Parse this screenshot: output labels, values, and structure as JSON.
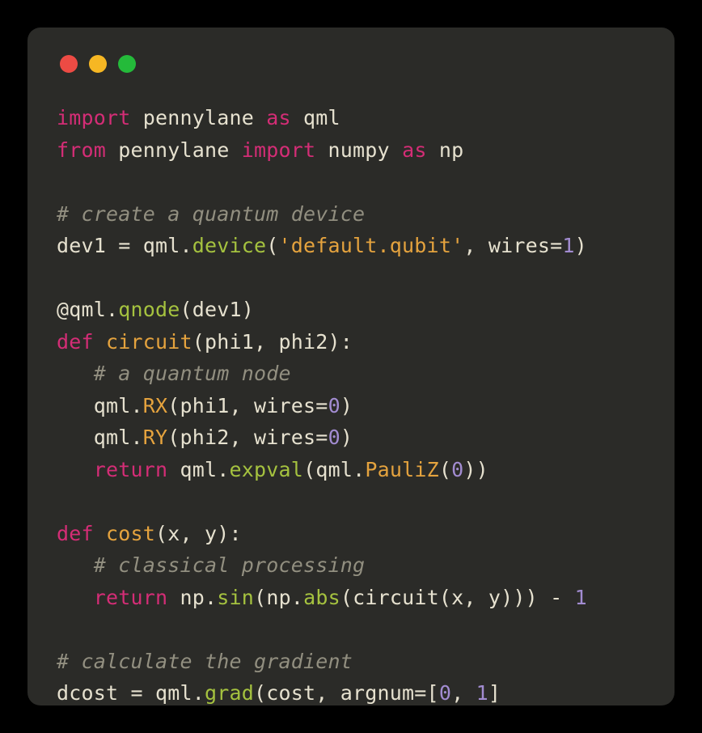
{
  "code": {
    "tokens": [
      [
        [
          "import ",
          "c-keyword"
        ],
        [
          "pennylane ",
          "c-default"
        ],
        [
          "as ",
          "c-keyword"
        ],
        [
          "qml",
          "c-default"
        ]
      ],
      [
        [
          "from ",
          "c-keyword"
        ],
        [
          "pennylane ",
          "c-default"
        ],
        [
          "import ",
          "c-keyword"
        ],
        [
          "numpy ",
          "c-default"
        ],
        [
          "as ",
          "c-keyword"
        ],
        [
          "np",
          "c-default"
        ]
      ],
      [],
      [
        [
          "# create a quantum device",
          "c-comment"
        ]
      ],
      [
        [
          "dev1 = qml.",
          "c-default"
        ],
        [
          "device",
          "c-func"
        ],
        [
          "(",
          "c-default"
        ],
        [
          "'default.qubit'",
          "c-string"
        ],
        [
          ", wires=",
          "c-default"
        ],
        [
          "1",
          "c-number"
        ],
        [
          ")",
          "c-default"
        ]
      ],
      [],
      [
        [
          "@qml.",
          "c-default"
        ],
        [
          "qnode",
          "c-func"
        ],
        [
          "(dev1)",
          "c-default"
        ]
      ],
      [
        [
          "def ",
          "c-keyword"
        ],
        [
          "circuit",
          "c-decor"
        ],
        [
          "(phi1, phi2):",
          "c-default"
        ]
      ],
      [
        [
          "   ",
          "c-default"
        ],
        [
          "# a quantum node",
          "c-comment"
        ]
      ],
      [
        [
          "   qml.",
          "c-default"
        ],
        [
          "RX",
          "c-decor"
        ],
        [
          "(phi1, wires=",
          "c-default"
        ],
        [
          "0",
          "c-number"
        ],
        [
          ")",
          "c-default"
        ]
      ],
      [
        [
          "   qml.",
          "c-default"
        ],
        [
          "RY",
          "c-decor"
        ],
        [
          "(phi2, wires=",
          "c-default"
        ],
        [
          "0",
          "c-number"
        ],
        [
          ")",
          "c-default"
        ]
      ],
      [
        [
          "   ",
          "c-default"
        ],
        [
          "return ",
          "c-keyword"
        ],
        [
          "qml.",
          "c-default"
        ],
        [
          "expval",
          "c-func"
        ],
        [
          "(qml.",
          "c-default"
        ],
        [
          "PauliZ",
          "c-decor"
        ],
        [
          "(",
          "c-default"
        ],
        [
          "0",
          "c-number"
        ],
        [
          "))",
          "c-default"
        ]
      ],
      [],
      [
        [
          "def ",
          "c-keyword"
        ],
        [
          "cost",
          "c-decor"
        ],
        [
          "(x, y):",
          "c-default"
        ]
      ],
      [
        [
          "   ",
          "c-default"
        ],
        [
          "# classical processing",
          "c-comment"
        ]
      ],
      [
        [
          "   ",
          "c-default"
        ],
        [
          "return ",
          "c-keyword"
        ],
        [
          "np.",
          "c-default"
        ],
        [
          "sin",
          "c-func"
        ],
        [
          "(np.",
          "c-default"
        ],
        [
          "abs",
          "c-func"
        ],
        [
          "(circuit(x, y))) - ",
          "c-default"
        ],
        [
          "1",
          "c-number"
        ]
      ],
      [],
      [
        [
          "# calculate the gradient",
          "c-comment"
        ]
      ],
      [
        [
          "dcost = qml.",
          "c-default"
        ],
        [
          "grad",
          "c-func"
        ],
        [
          "(cost, argnum=[",
          "c-default"
        ],
        [
          "0",
          "c-number"
        ],
        [
          ", ",
          "c-default"
        ],
        [
          "1",
          "c-number"
        ],
        [
          "]",
          "c-default"
        ]
      ]
    ]
  }
}
